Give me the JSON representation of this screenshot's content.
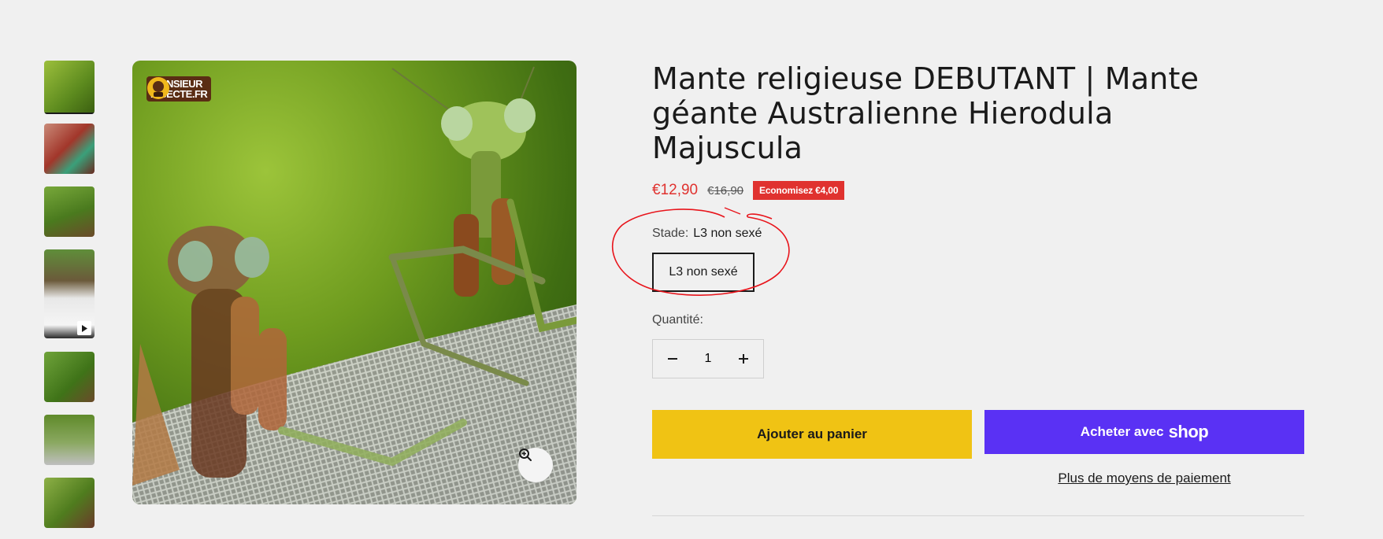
{
  "product": {
    "title": "Mante religieuse DEBUTANT | Mante géante Australienne Hierodula Majuscula",
    "price_sale": "€12,90",
    "price_compare": "€16,90",
    "save_badge": "Economisez €4,00"
  },
  "brand_logo": {
    "text_line1": "MONSIEUR",
    "text_line2": "INSECTE.FR"
  },
  "gallery": {
    "thumbnails": [
      {
        "name": "thumbnail-1",
        "active": true
      },
      {
        "name": "thumbnail-2",
        "active": false
      },
      {
        "name": "thumbnail-3",
        "active": false
      },
      {
        "name": "thumbnail-4-video",
        "active": false,
        "video": true
      },
      {
        "name": "thumbnail-5",
        "active": false
      },
      {
        "name": "thumbnail-6",
        "active": false
      },
      {
        "name": "thumbnail-7",
        "active": false
      }
    ],
    "zoom_icon": "zoom-in-icon",
    "play_icon": "play-icon"
  },
  "variant": {
    "label": "Stade:",
    "selected": "L3 non sexé",
    "options": [
      "L3 non sexé"
    ]
  },
  "quantity": {
    "label": "Quantité:",
    "value": "1",
    "minus_icon": "minus-icon",
    "plus_icon": "plus-icon"
  },
  "buttons": {
    "add_to_cart": "Ajouter au panier",
    "buy_with": "Acheter avec",
    "shop_wordmark": "shop",
    "more_payment": "Plus de moyens de paiement"
  },
  "colors": {
    "sale_red": "#e0322f",
    "add_to_cart_yellow": "#f0c314",
    "shop_pay_purple": "#5a31f4",
    "annotation_red": "#e8141b"
  }
}
